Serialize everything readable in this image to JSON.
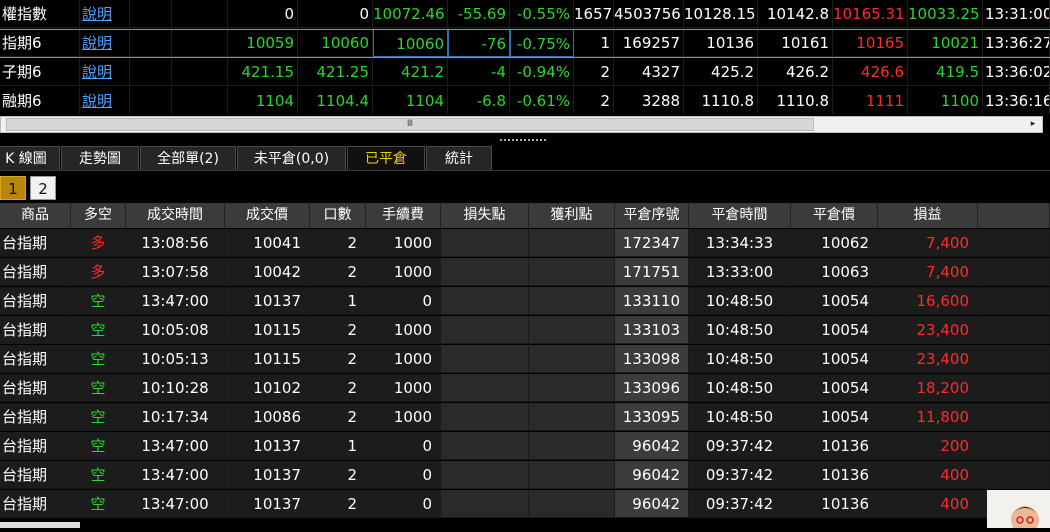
{
  "quote": {
    "rows": [
      {
        "name": "權指數",
        "link": "說明",
        "bid": "0",
        "ask": "0",
        "last": "10072.46",
        "chg": "-55.69",
        "pct": "-0.55%",
        "vol": "1657",
        "tvol": "4503756",
        "open": "10128.15",
        "ref": "10142.8",
        "high": "10165.31",
        "low": "10033.25",
        "time": "13:31:00"
      },
      {
        "name": "指期6",
        "link": "說明",
        "bid": "10059",
        "ask": "10060",
        "last": "10060",
        "chg": "-76",
        "pct": "-0.75%",
        "vol": "1",
        "tvol": "169257",
        "open": "10136",
        "ref": "10161",
        "high": "10165",
        "low": "10021",
        "time": "13:36:27"
      },
      {
        "name": "子期6",
        "link": "說明",
        "bid": "421.15",
        "ask": "421.25",
        "last": "421.2",
        "chg": "-4",
        "pct": "-0.94%",
        "vol": "2",
        "tvol": "4327",
        "open": "425.2",
        "ref": "426.2",
        "high": "426.6",
        "low": "419.5",
        "time": "13:36:02"
      },
      {
        "name": "融期6",
        "link": "說明",
        "bid": "1104",
        "ask": "1104.4",
        "last": "1104",
        "chg": "-6.8",
        "pct": "-0.61%",
        "vol": "2",
        "tvol": "3288",
        "open": "1110.8",
        "ref": "1110.8",
        "high": "1111",
        "low": "1100",
        "time": "13:36:16"
      }
    ]
  },
  "scrollbar": {
    "thumb_grip": "Ⅲ",
    "right_arrow": "▸"
  },
  "tabs": [
    "K 線圖",
    "走勢圖",
    "全部單(2)",
    "未平倉(0,0)",
    "已平倉",
    "統計"
  ],
  "active_tab": "已平倉",
  "pages": [
    "1",
    "2"
  ],
  "grid": {
    "headers": [
      "商品",
      "多空",
      "成交時間",
      "成交價",
      "口數",
      "手續費",
      "損失點",
      "獲利點",
      "平倉序號",
      "平倉時間",
      "平倉價",
      "損益"
    ],
    "rows": [
      {
        "product": "台指期",
        "side": "多",
        "time": "13:08:56",
        "price": "10041",
        "qty": "2",
        "fee": "1000",
        "loss": "",
        "profit": "",
        "close_no": "172347",
        "close_time": "13:34:33",
        "close_price": "10062",
        "pnl": "7,400"
      },
      {
        "product": "台指期",
        "side": "多",
        "time": "13:07:58",
        "price": "10042",
        "qty": "2",
        "fee": "1000",
        "loss": "",
        "profit": "",
        "close_no": "171751",
        "close_time": "13:33:00",
        "close_price": "10063",
        "pnl": "7,400"
      },
      {
        "product": "台指期",
        "side": "空",
        "time": "13:47:00",
        "price": "10137",
        "qty": "1",
        "fee": "0",
        "loss": "",
        "profit": "",
        "close_no": "133110",
        "close_time": "10:48:50",
        "close_price": "10054",
        "pnl": "16,600"
      },
      {
        "product": "台指期",
        "side": "空",
        "time": "10:05:08",
        "price": "10115",
        "qty": "2",
        "fee": "1000",
        "loss": "",
        "profit": "",
        "close_no": "133103",
        "close_time": "10:48:50",
        "close_price": "10054",
        "pnl": "23,400"
      },
      {
        "product": "台指期",
        "side": "空",
        "time": "10:05:13",
        "price": "10115",
        "qty": "2",
        "fee": "1000",
        "loss": "",
        "profit": "",
        "close_no": "133098",
        "close_time": "10:48:50",
        "close_price": "10054",
        "pnl": "23,400"
      },
      {
        "product": "台指期",
        "side": "空",
        "time": "10:10:28",
        "price": "10102",
        "qty": "2",
        "fee": "1000",
        "loss": "",
        "profit": "",
        "close_no": "133096",
        "close_time": "10:48:50",
        "close_price": "10054",
        "pnl": "18,200"
      },
      {
        "product": "台指期",
        "side": "空",
        "time": "10:17:34",
        "price": "10086",
        "qty": "2",
        "fee": "1000",
        "loss": "",
        "profit": "",
        "close_no": "133095",
        "close_time": "10:48:50",
        "close_price": "10054",
        "pnl": "11,800"
      },
      {
        "product": "台指期",
        "side": "空",
        "time": "13:47:00",
        "price": "10137",
        "qty": "1",
        "fee": "0",
        "loss": "",
        "profit": "",
        "close_no": "96042",
        "close_time": "09:37:42",
        "close_price": "10136",
        "pnl": "200"
      },
      {
        "product": "台指期",
        "side": "空",
        "time": "13:47:00",
        "price": "10137",
        "qty": "2",
        "fee": "0",
        "loss": "",
        "profit": "",
        "close_no": "96042",
        "close_time": "09:37:42",
        "close_price": "10136",
        "pnl": "400"
      },
      {
        "product": "台指期",
        "side": "空",
        "time": "13:47:00",
        "price": "10137",
        "qty": "2",
        "fee": "0",
        "loss": "",
        "profit": "",
        "close_no": "96042",
        "close_time": "09:37:42",
        "close_price": "10136",
        "pnl": "400"
      }
    ]
  },
  "colors": {
    "up": "#ff2a2a",
    "down": "#2bd62b",
    "link": "#4aa3ff",
    "active_tab": "#f0d000"
  }
}
